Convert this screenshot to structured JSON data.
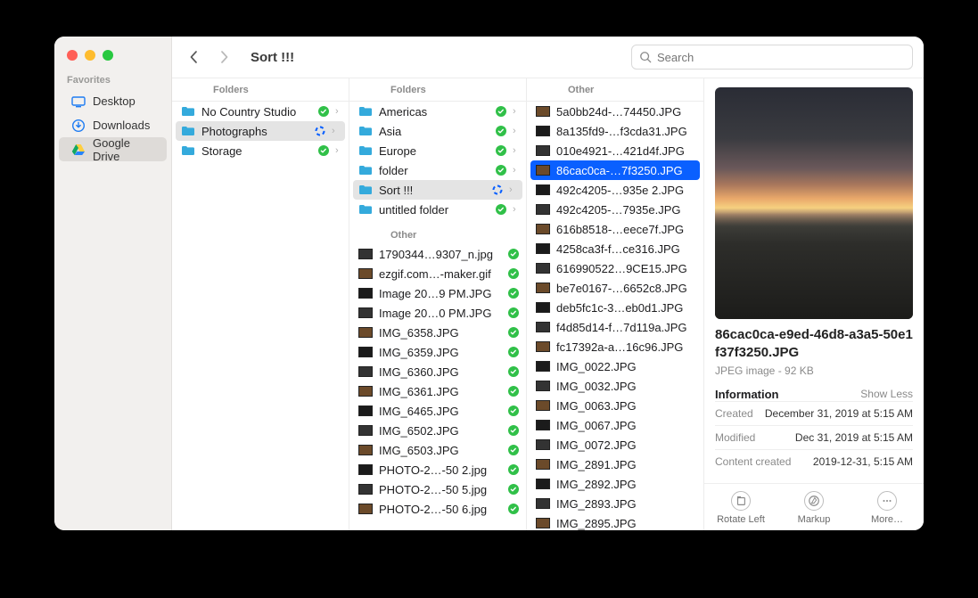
{
  "sidebar": {
    "favorites_label": "Favorites",
    "items": [
      {
        "label": "Desktop"
      },
      {
        "label": "Downloads"
      },
      {
        "label": "Google Drive"
      }
    ],
    "selected_index": 2
  },
  "toolbar": {
    "title": "Sort !!!",
    "search_placeholder": "Search"
  },
  "groups": {
    "folders": "Folders",
    "other": "Other"
  },
  "column1": {
    "header": "Folders",
    "items": [
      {
        "name": "No Country Studio",
        "status": "check",
        "chev": true
      },
      {
        "name": "Photographs",
        "status": "sync",
        "chev": true,
        "selected": true
      },
      {
        "name": "Storage",
        "status": "check",
        "chev": true
      }
    ]
  },
  "column2": {
    "header": "Folders",
    "items": [
      {
        "name": "Americas",
        "status": "check",
        "chev": true
      },
      {
        "name": "Asia",
        "status": "check",
        "chev": true
      },
      {
        "name": "Europe",
        "status": "check",
        "chev": true
      },
      {
        "name": "folder",
        "status": "check",
        "chev": true
      },
      {
        "name": "Sort !!!",
        "status": "sync",
        "chev": true,
        "selected": true
      },
      {
        "name": "untitled folder",
        "status": "check",
        "chev": true
      }
    ],
    "other_header": "Other",
    "other_items": [
      {
        "name": "1790344…9307_n.jpg",
        "status": "check"
      },
      {
        "name": "ezgif.com…-maker.gif",
        "status": "check"
      },
      {
        "name": "Image 20…9 PM.JPG",
        "status": "check"
      },
      {
        "name": "Image 20…0 PM.JPG",
        "status": "check"
      },
      {
        "name": "IMG_6358.JPG",
        "status": "check"
      },
      {
        "name": "IMG_6359.JPG",
        "status": "check"
      },
      {
        "name": "IMG_6360.JPG",
        "status": "check"
      },
      {
        "name": "IMG_6361.JPG",
        "status": "check"
      },
      {
        "name": "IMG_6465.JPG",
        "status": "check"
      },
      {
        "name": "IMG_6502.JPG",
        "status": "check"
      },
      {
        "name": "IMG_6503.JPG",
        "status": "check"
      },
      {
        "name": "PHOTO-2…-50 2.jpg",
        "status": "check"
      },
      {
        "name": "PHOTO-2…-50 5.jpg",
        "status": "check"
      },
      {
        "name": "PHOTO-2…-50 6.jpg",
        "status": "check"
      }
    ]
  },
  "column3": {
    "header": "Other",
    "items": [
      {
        "name": "5a0bb24d-…74450.JPG"
      },
      {
        "name": "8a135fd9-…f3cda31.JPG"
      },
      {
        "name": "010e4921-…421d4f.JPG"
      },
      {
        "name": "86cac0ca-…7f3250.JPG",
        "selected": true
      },
      {
        "name": "492c4205-…935e 2.JPG"
      },
      {
        "name": "492c4205-…7935e.JPG"
      },
      {
        "name": "616b8518-…eece7f.JPG"
      },
      {
        "name": "4258ca3f-f…ce316.JPG"
      },
      {
        "name": "616990522…9CE15.JPG"
      },
      {
        "name": "be7e0167-…6652c8.JPG"
      },
      {
        "name": "deb5fc1c-3…eb0d1.JPG"
      },
      {
        "name": "f4d85d14-f…7d119a.JPG"
      },
      {
        "name": "fc17392a-a…16c96.JPG"
      },
      {
        "name": "IMG_0022.JPG"
      },
      {
        "name": "IMG_0032.JPG"
      },
      {
        "name": "IMG_0063.JPG"
      },
      {
        "name": "IMG_0067.JPG"
      },
      {
        "name": "IMG_0072.JPG"
      },
      {
        "name": "IMG_2891.JPG"
      },
      {
        "name": "IMG_2892.JPG"
      },
      {
        "name": "IMG_2893.JPG"
      },
      {
        "name": "IMG_2895.JPG"
      }
    ]
  },
  "preview": {
    "filename": "86cac0ca-e9ed-46d8-a3a5-50e1f37f3250.JPG",
    "kind_size": "JPEG image - 92 KB",
    "info_label": "Information",
    "toggle_label": "Show Less",
    "rows": [
      {
        "k": "Created",
        "v": "December 31, 2019 at 5:15 AM"
      },
      {
        "k": "Modified",
        "v": "Dec 31, 2019 at 5:15 AM"
      },
      {
        "k": "Content created",
        "v": "2019-12-31, 5:15 AM"
      }
    ],
    "actions": {
      "rotate": "Rotate Left",
      "markup": "Markup",
      "more": "More…"
    }
  }
}
